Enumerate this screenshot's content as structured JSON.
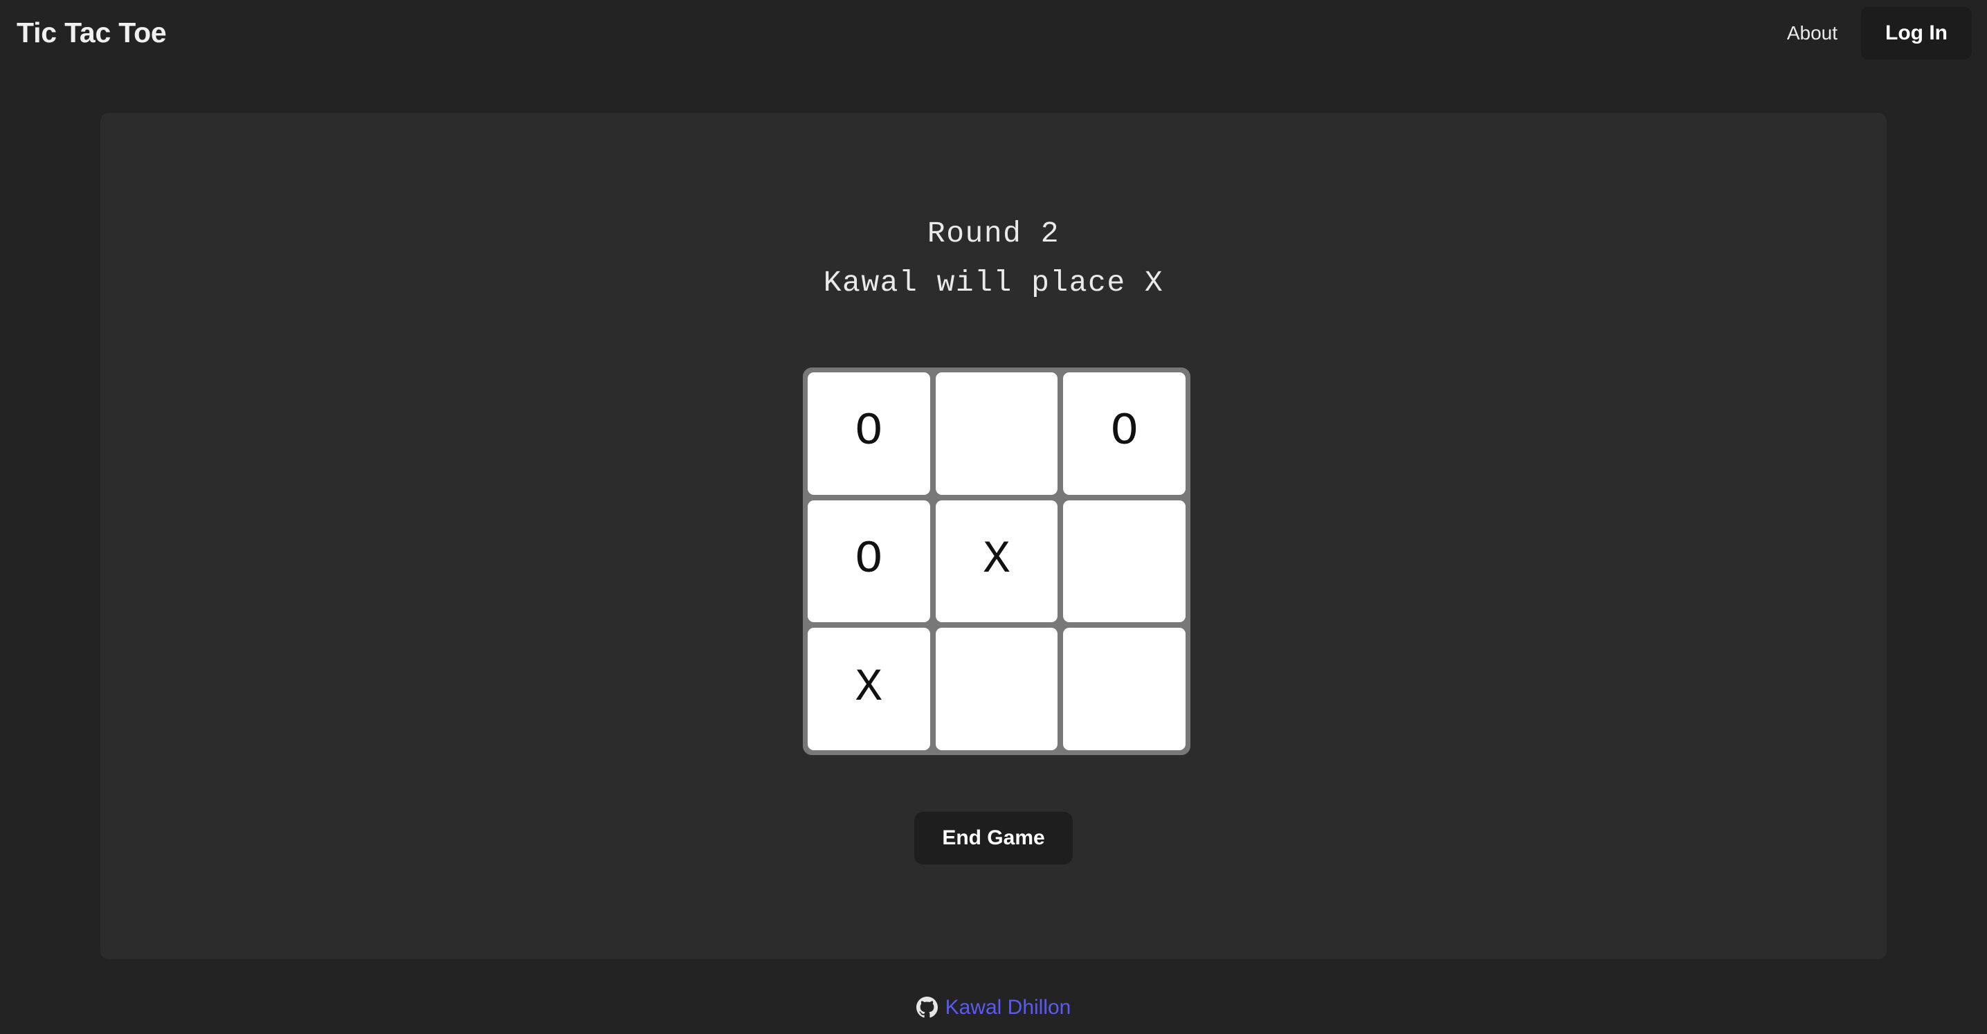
{
  "navbar": {
    "brand": "Tic Tac Toe",
    "about_label": "About",
    "login_label": "Log In"
  },
  "game": {
    "round_label": "Round 2",
    "turn_label": "Kawal will place X",
    "end_game_label": "End Game",
    "board": [
      {
        "index": 0,
        "mark": "O"
      },
      {
        "index": 1,
        "mark": ""
      },
      {
        "index": 2,
        "mark": "O"
      },
      {
        "index": 3,
        "mark": "O"
      },
      {
        "index": 4,
        "mark": "X"
      },
      {
        "index": 5,
        "mark": ""
      },
      {
        "index": 6,
        "mark": "X"
      },
      {
        "index": 7,
        "mark": ""
      },
      {
        "index": 8,
        "mark": ""
      }
    ]
  },
  "footer": {
    "icon": "github-icon",
    "author_label": "Kawal Dhillon"
  },
  "colors": {
    "page_background": "#232323",
    "panel_background": "#2c2c2c",
    "navbar_background": "#232323",
    "button_background": "#1e1e1e",
    "board_grid": "#787878",
    "cell_background": "#ffffff",
    "mark_color": "#111111",
    "link_accent": "#5a5af5",
    "text_primary": "#eaeaea"
  }
}
